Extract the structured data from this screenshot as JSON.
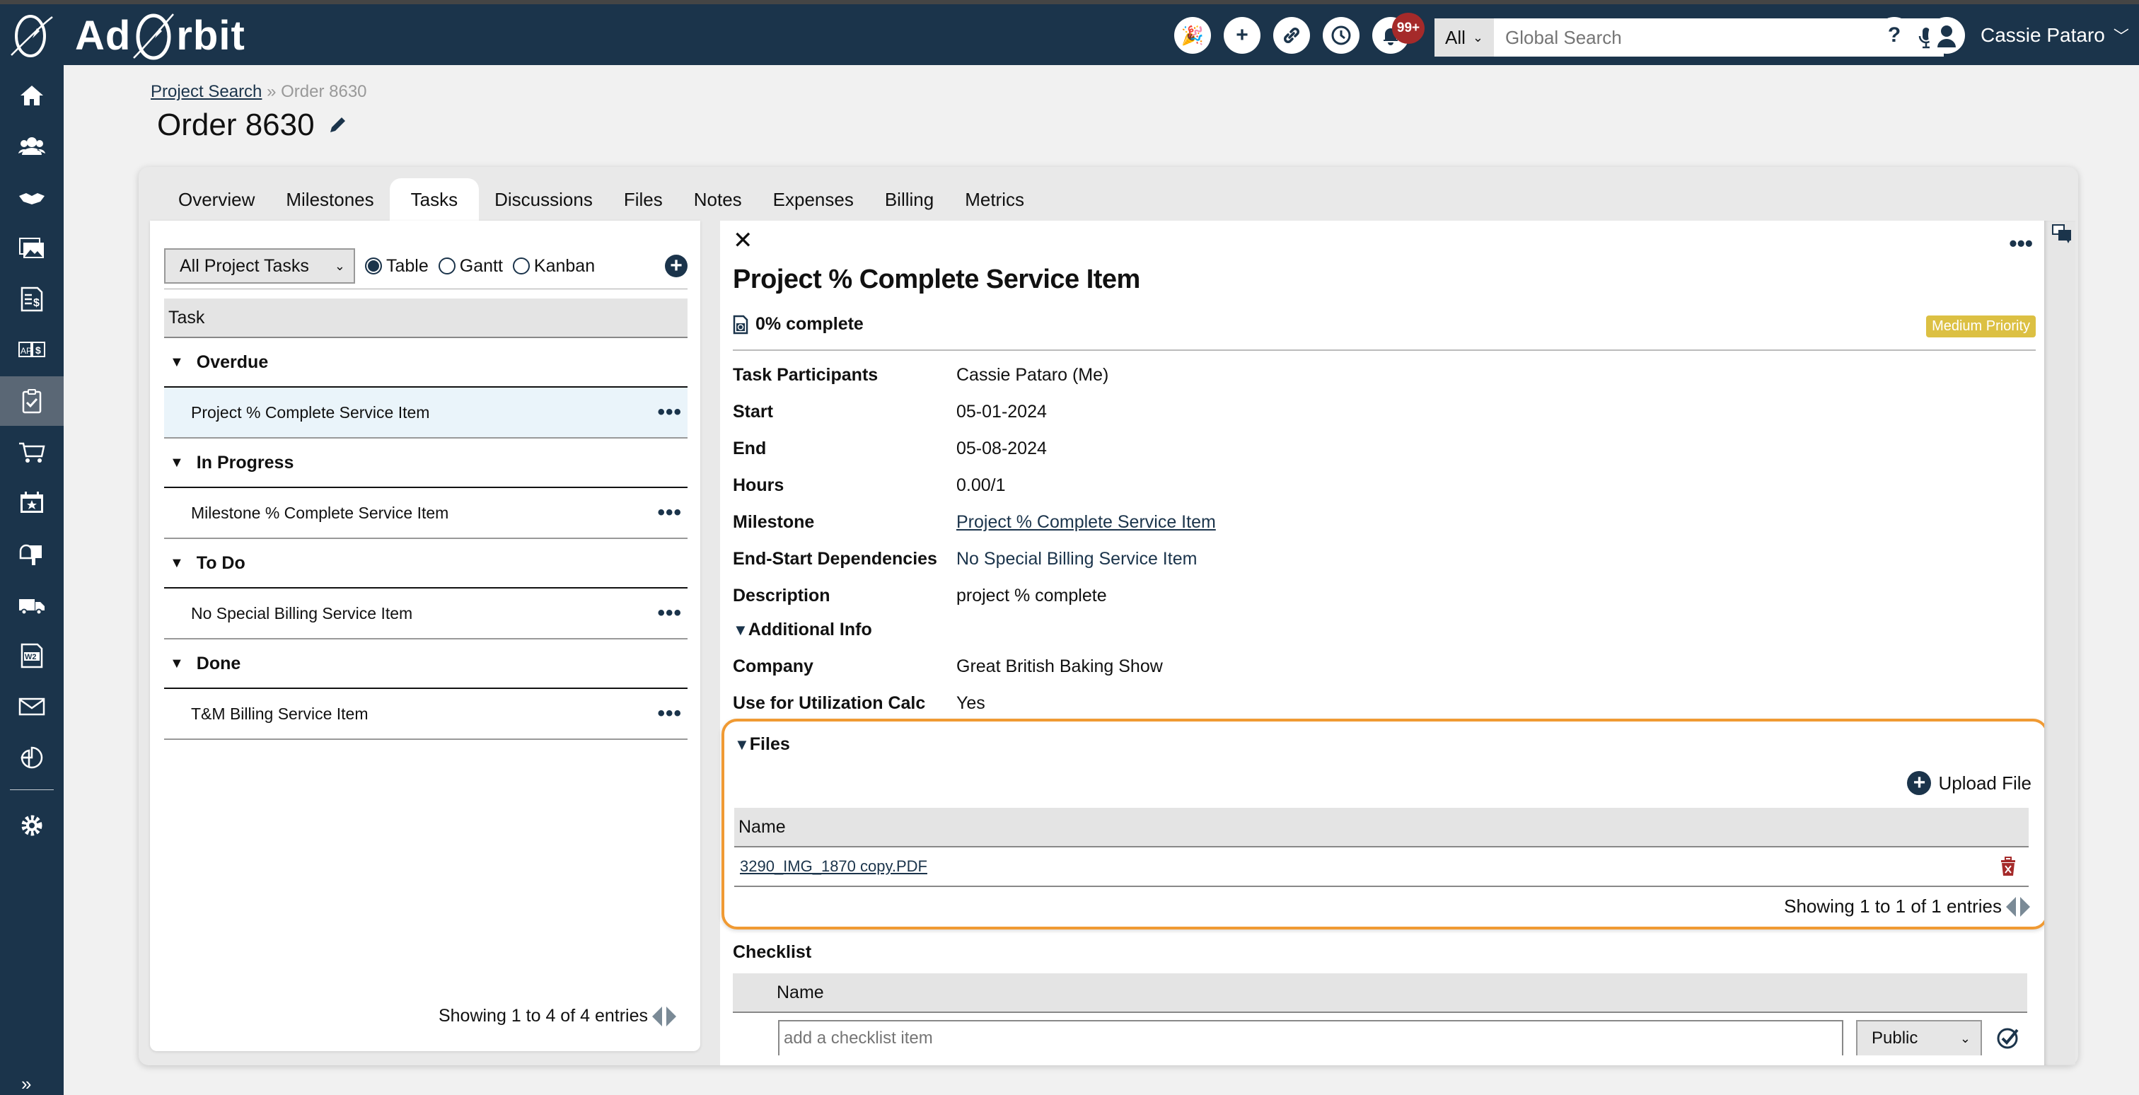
{
  "app": {
    "name_part1": "Ad",
    "name_part2": "rbit",
    "logo_icon": "planet-rocket-logo"
  },
  "header": {
    "icons": [
      "celebration-icon",
      "plus-icon",
      "link-icon",
      "history-icon",
      "bell-icon"
    ],
    "notification_badge": "99+",
    "search": {
      "scope": "All",
      "placeholder": "Global Search"
    },
    "help_label": "?",
    "user_name": "Cassie Pataro"
  },
  "sidebar": {
    "items": [
      {
        "icon": "home-icon"
      },
      {
        "icon": "customers-icon"
      },
      {
        "icon": "handshake-icon"
      },
      {
        "icon": "media-icon"
      },
      {
        "icon": "invoice-icon"
      },
      {
        "icon": "ap-ar-icon"
      },
      {
        "icon": "tasks-clipboard-icon",
        "active": true
      },
      {
        "icon": "cart-icon"
      },
      {
        "icon": "calendar-star-icon"
      },
      {
        "icon": "mailbox-icon"
      },
      {
        "icon": "truck-icon"
      },
      {
        "icon": "w2-icon"
      },
      {
        "icon": "mail-icon"
      },
      {
        "icon": "chart-icon"
      },
      {
        "icon": "settings-gear-icon"
      }
    ],
    "expand_label": "»"
  },
  "breadcrumb": {
    "parent": "Project Search",
    "separator": "»",
    "current": "Order 8630"
  },
  "page": {
    "title": "Order 8630"
  },
  "tabs": [
    {
      "label": "Overview"
    },
    {
      "label": "Milestones"
    },
    {
      "label": "Tasks",
      "active": true
    },
    {
      "label": "Discussions"
    },
    {
      "label": "Files"
    },
    {
      "label": "Notes"
    },
    {
      "label": "Expenses"
    },
    {
      "label": "Billing"
    },
    {
      "label": "Metrics"
    }
  ],
  "task_list": {
    "filter": "All Project Tasks",
    "views": [
      {
        "label": "Table",
        "checked": true
      },
      {
        "label": "Gantt",
        "checked": false
      },
      {
        "label": "Kanban",
        "checked": false
      }
    ],
    "column_header": "Task",
    "groups": [
      {
        "name": "Overdue",
        "tasks": [
          {
            "name": "Project % Complete Service Item",
            "selected": true
          }
        ]
      },
      {
        "name": "In Progress",
        "tasks": [
          {
            "name": "Milestone % Complete Service Item"
          }
        ]
      },
      {
        "name": "To Do",
        "tasks": [
          {
            "name": "No Special Billing Service Item"
          }
        ]
      },
      {
        "name": "Done",
        "tasks": [
          {
            "name": "T&M Billing Service Item"
          }
        ]
      }
    ],
    "footer": "Showing 1 to 4 of 4 entries"
  },
  "task_detail": {
    "close_label": "✕",
    "more_label": "•••",
    "title": "Project % Complete Service Item",
    "progress_text": "0% complete",
    "progress_value": 0,
    "priority": "Medium Priority",
    "priority_color": "#dcc043",
    "fields": [
      {
        "label": "Task Participants",
        "value": "Cassie Pataro (Me)"
      },
      {
        "label": "Start",
        "value": "05-01-2024"
      },
      {
        "label": "End",
        "value": "05-08-2024"
      },
      {
        "label": "Hours",
        "value": "0.00/1"
      },
      {
        "label": "Milestone",
        "value": "Project % Complete Service Item"
      },
      {
        "label": "End-Start Dependencies",
        "value": "No Special Billing Service Item"
      },
      {
        "label": "Description",
        "value": "project % complete"
      }
    ],
    "additional_info": {
      "heading": "Additional Info",
      "fields": [
        {
          "label": "Company",
          "value": "Great British Baking Show"
        },
        {
          "label": "Use for Utilization Calc",
          "value": "Yes"
        }
      ]
    },
    "files": {
      "heading": "Files",
      "upload_label": "Upload File",
      "column_header": "Name",
      "rows": [
        {
          "name": "3290_IMG_1870 copy.PDF"
        }
      ],
      "footer": "Showing 1 to 1 of 1 entries",
      "highlight_color": "#f09a33"
    },
    "checklist": {
      "heading": "Checklist",
      "column_header": "Name",
      "input_placeholder": "add a checklist item",
      "visibility": "Public"
    }
  },
  "colors": {
    "brand_navy": "#1b344b",
    "sidebar_active": "#5a6775",
    "delete_red": "#a52a2a"
  }
}
